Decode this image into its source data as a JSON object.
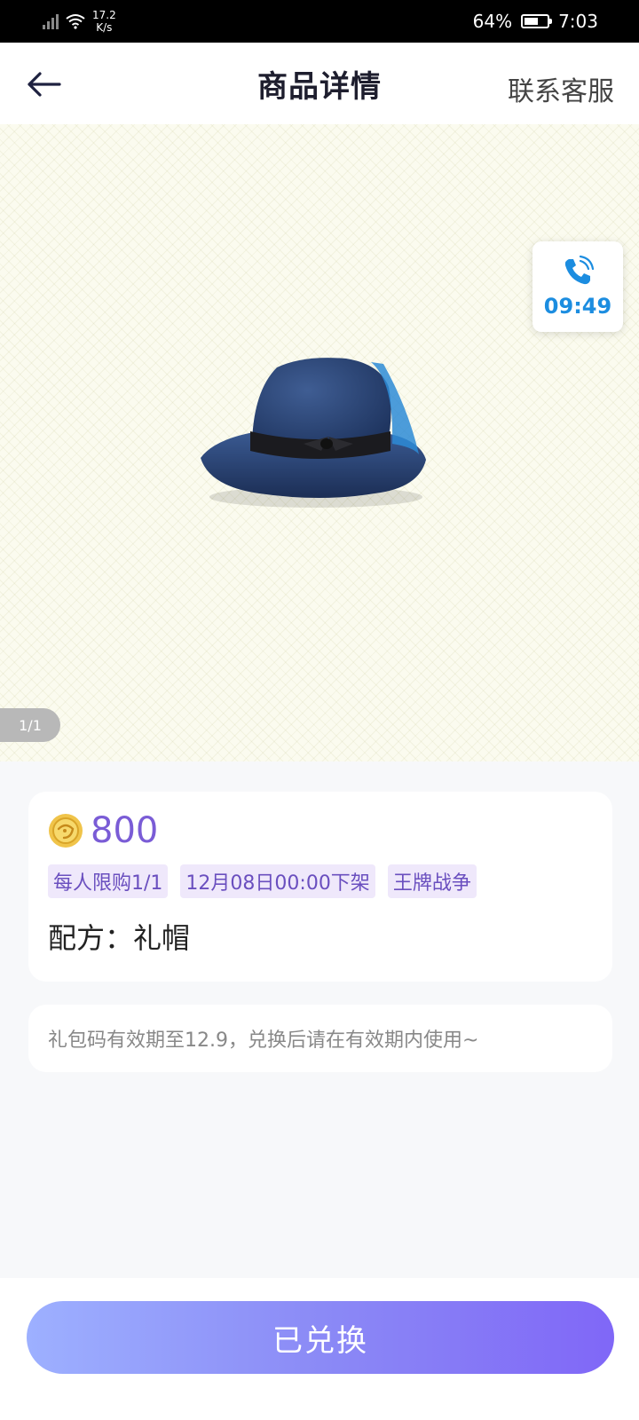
{
  "status_bar": {
    "net_speed_value": "17.2",
    "net_speed_unit": "K/s",
    "battery": "64%",
    "time": "7:03"
  },
  "header": {
    "title": "商品详情",
    "contact": "联系客服"
  },
  "hero": {
    "pager": "1/1",
    "call_timer": "09:49",
    "image": "blue-fedora-hat"
  },
  "product": {
    "price": "800",
    "tags": [
      "每人限购1/1",
      "12月08日00:00下架",
      "王牌战争"
    ],
    "recipe": "配方：礼帽"
  },
  "note": "礼包码有效期至12.9，兑换后请在有效期内使用~",
  "action": {
    "label": "已兑换"
  },
  "colors": {
    "accent": "#7a5cd6",
    "call_blue": "#1c8de0",
    "button_start": "#9db0ff",
    "button_end": "#8067f7"
  }
}
